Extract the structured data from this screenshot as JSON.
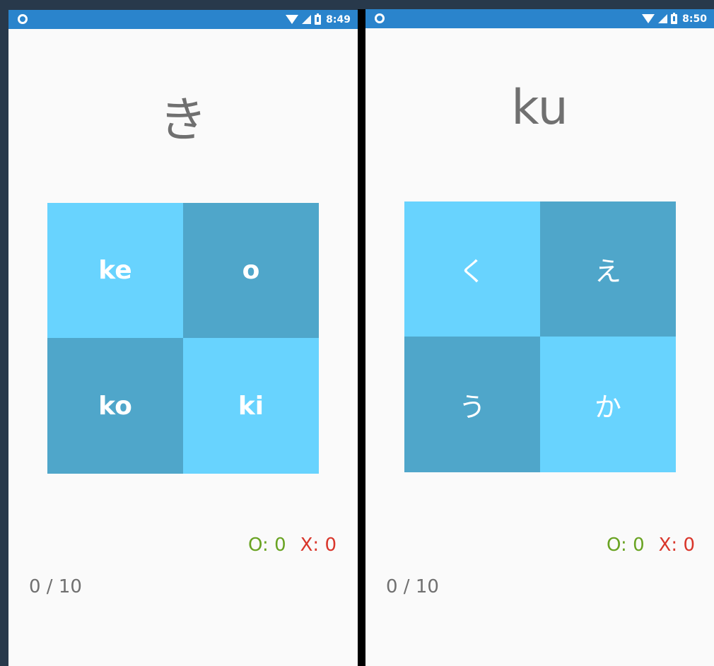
{
  "screens": [
    {
      "status": {
        "time": "8:49"
      },
      "prompt": "き",
      "tiles": [
        "ke",
        "o",
        "ko",
        "ki"
      ],
      "score": {
        "correct": "O: 0",
        "wrong": "X: 0"
      },
      "progress": "0 / 10"
    },
    {
      "status": {
        "time": "8:50"
      },
      "prompt": "ku",
      "tiles": [
        "く",
        "え",
        "う",
        "か"
      ],
      "score": {
        "correct": "O: 0",
        "wrong": "X: 0"
      },
      "progress": "0 / 10"
    }
  ],
  "colors": {
    "status_bar": "#2a84cc",
    "tile_light": "#68d3fe",
    "tile_dark": "#4fa6ca",
    "correct": "#69a322",
    "wrong": "#d9362b",
    "text_gray": "#707070"
  }
}
